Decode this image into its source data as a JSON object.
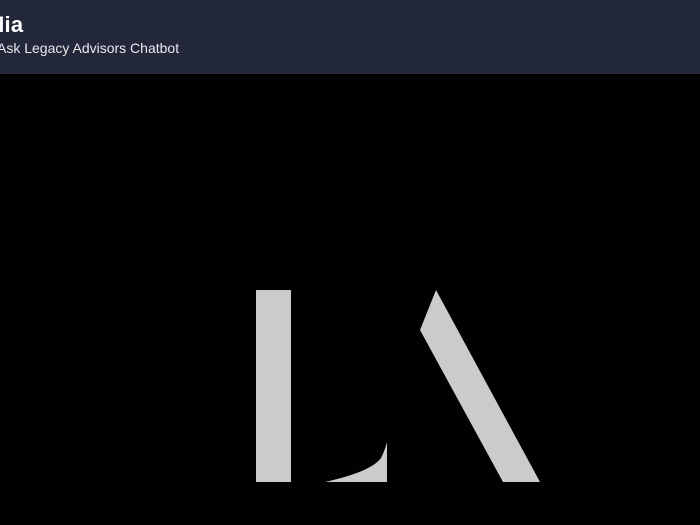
{
  "header": {
    "title": "Mia",
    "subtitle": "Ask Legacy Advisors Chatbot"
  },
  "logo": {
    "icon": "legacy-advisors-logo-icon",
    "letters": "LA",
    "color": "#cbcacd"
  },
  "colors": {
    "header_bg": "#222739",
    "page_bg": "#010102"
  }
}
